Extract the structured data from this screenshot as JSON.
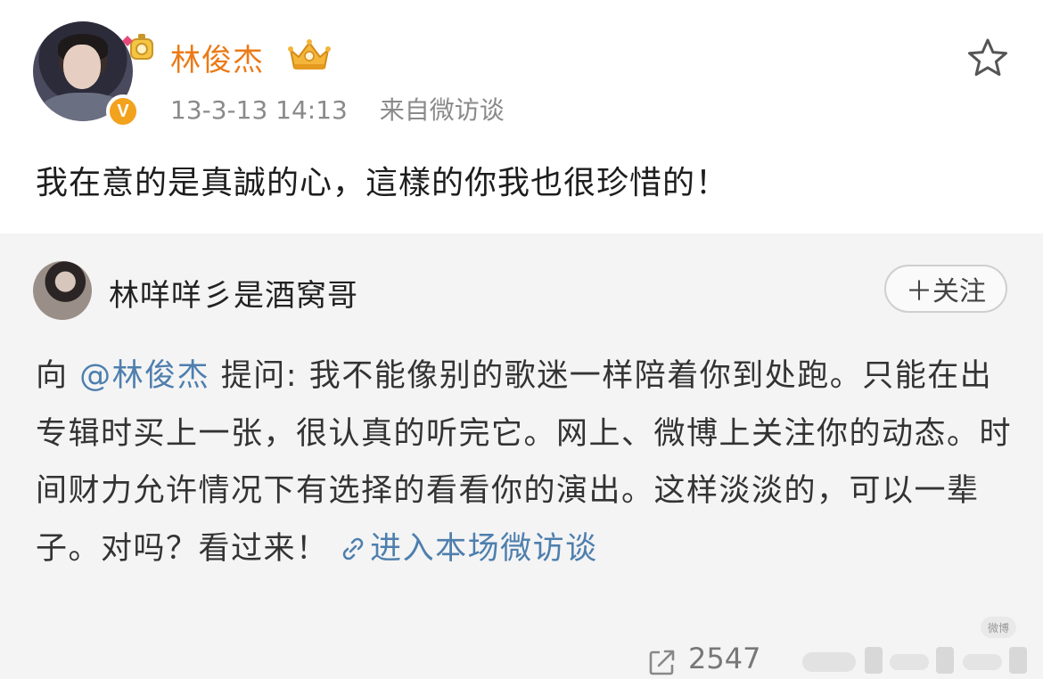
{
  "post": {
    "author": "林俊杰",
    "verified_badge": "V",
    "timestamp": "13-3-13 14:13",
    "source": "来自微访谈",
    "text": "我在意的是真誠的心，這樣的你我也很珍惜的！",
    "colors": {
      "author": "#eb7a17",
      "meta": "#8a8a8a"
    }
  },
  "quote": {
    "author": "林咩咩彡是酒窝哥",
    "follow_label": "＋关注",
    "prefix": "向 ",
    "mention": "@林俊杰",
    "question": " 提问: 我不能像别的歌迷一样陪着你到处跑。只能在出专辑时买上一张，很认真的听完它。网上、微博上关注你的动态。时间财力允许情况下有选择的看看你的演出。这样淡淡的，可以一辈子。对吗？看过来！ ",
    "link_text": "进入本场微访谈",
    "colors": {
      "link": "#4e7fae",
      "background": "#f4f4f4"
    }
  },
  "footer": {
    "share_count": "2547",
    "watermark": "微博",
    "icons": [
      "share-icon",
      "blurred-stats"
    ]
  },
  "icons": [
    "star-icon",
    "crown-icon",
    "chain-link-icon",
    "verified-badge-icon"
  ]
}
